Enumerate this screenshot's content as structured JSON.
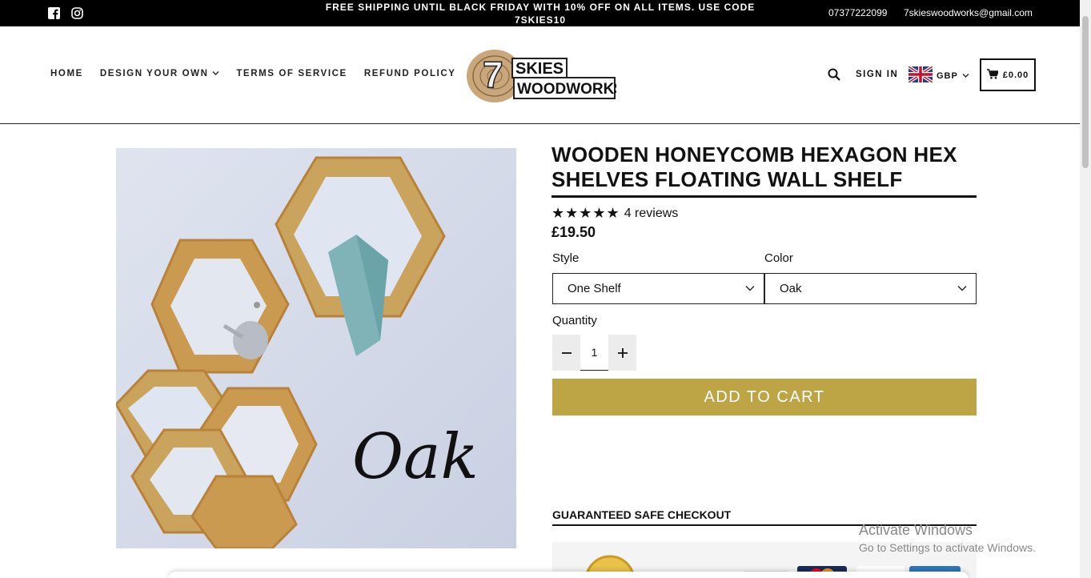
{
  "announcement": {
    "message": "FREE SHIPPING UNTIL BLACK FRIDAY WITH 10% OFF ON ALL ITEMS. USE CODE 7SKIES10",
    "phone": "07377222099",
    "email": "7skieswoodworks@gmail.com"
  },
  "nav": {
    "items": [
      "HOME",
      "DESIGN YOUR OWN",
      "TERMS OF SERVICE",
      "REFUND POLICY"
    ]
  },
  "logo": {
    "line1": "SKIES",
    "line2": "WOODWORKS",
    "mark": "7"
  },
  "header": {
    "signin": "SIGN IN",
    "currency": "GBP",
    "cart_total": "£0.00"
  },
  "product": {
    "image_caption": "Oak",
    "title": "WOODEN HONEYCOMB HEXAGON HEX SHELVES FLOATING WALL SHELF",
    "stars": "★★★★★",
    "reviews": "4 reviews",
    "price": "£19.50",
    "style_label": "Style",
    "style_value": "One Shelf",
    "color_label": "Color",
    "color_value": "Oak",
    "quantity_label": "Quantity",
    "quantity_value": "1",
    "add_to_cart": "ADD TO CART",
    "safe_checkout": "GUARANTEED SAFE CHECKOUT"
  },
  "watermark": {
    "line1": "Activate Windows",
    "line2": "Go to Settings to activate Windows."
  },
  "colors": {
    "accent": "#bda546",
    "bar": "#000000"
  }
}
